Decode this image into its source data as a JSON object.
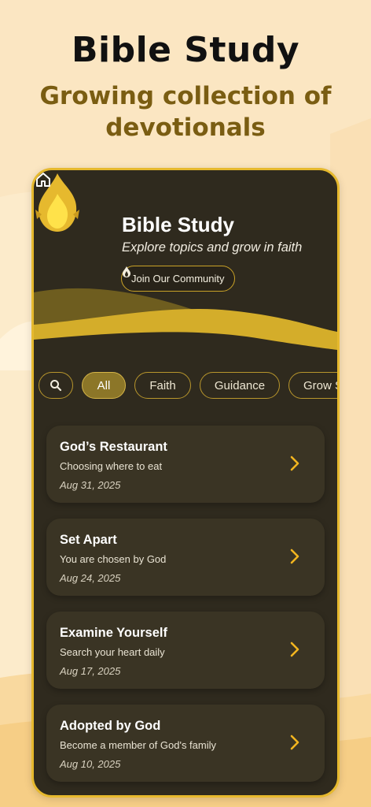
{
  "promo": {
    "title": "Bible Study",
    "subtitle_line1": "Growing collection of",
    "subtitle_line2": "devotionals"
  },
  "app": {
    "title": "Bible Study",
    "subtitle": "Explore topics and grow in faith",
    "community_button": "Join Our Community"
  },
  "filters": [
    "All",
    "Faith",
    "Guidance",
    "Grow S"
  ],
  "active_filter": "All",
  "devotionals": [
    {
      "title": "God’s Restaurant",
      "subtitle": "Choosing where to eat",
      "date": "Aug 31, 2025"
    },
    {
      "title": "Set Apart",
      "subtitle": "You are chosen by God",
      "date": "Aug 24, 2025"
    },
    {
      "title": "Examine Yourself",
      "subtitle": "Search your heart daily",
      "date": "Aug 17, 2025"
    },
    {
      "title": "Adopted by God",
      "subtitle": "Become a member of God's family",
      "date": "Aug 10, 2025"
    }
  ],
  "icons": {
    "logo": "flame-icon",
    "home": "home-icon",
    "community": "fire-icon",
    "search": "search-icon",
    "card_action": "chevron-right-icon"
  },
  "colors": {
    "background": "#FBE6C2",
    "phone_bg": "#2F2A1E",
    "accent": "#E6B92E",
    "card_bg": "#3A3424",
    "promo_subtitle": "#7A5D12"
  }
}
